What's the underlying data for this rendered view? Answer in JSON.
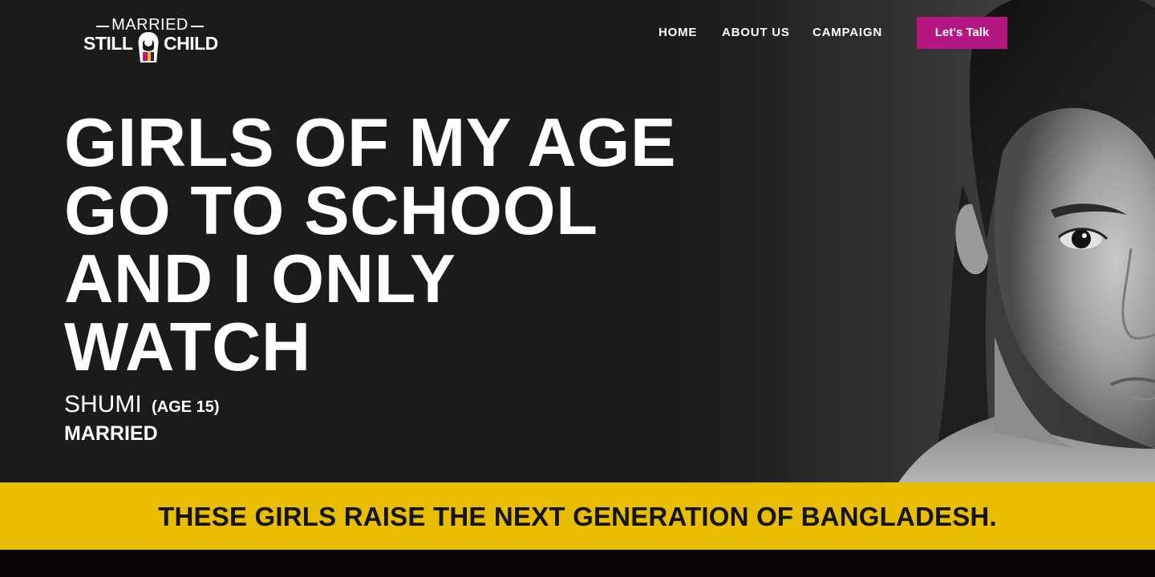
{
  "header": {
    "logo": {
      "top_text": "MARRIED",
      "left_text": "STILL",
      "right_text": "CHILD",
      "icon": "child-bride-icon"
    },
    "nav": [
      "HOME",
      "ABOUT US",
      "CAMPAIGN"
    ],
    "cta_label": "Let's Talk"
  },
  "hero": {
    "quote_lines": [
      "GIRLS OF MY AGE",
      "GO TO SCHOOL",
      "AND I ONLY",
      "WATCH"
    ],
    "name": "SHUMI",
    "age": "(AGE 15)",
    "status": "MARRIED",
    "image": "portrait-girl-photo"
  },
  "banner": {
    "text": "THESE GIRLS RAISE THE NEXT GENERATION OF BANGLADESH."
  },
  "colors": {
    "hero_background": "#1b1b1b",
    "cta": "#b5167f",
    "banner": "#e8bd02",
    "banner_text": "#141414",
    "bottom": "#050304"
  }
}
